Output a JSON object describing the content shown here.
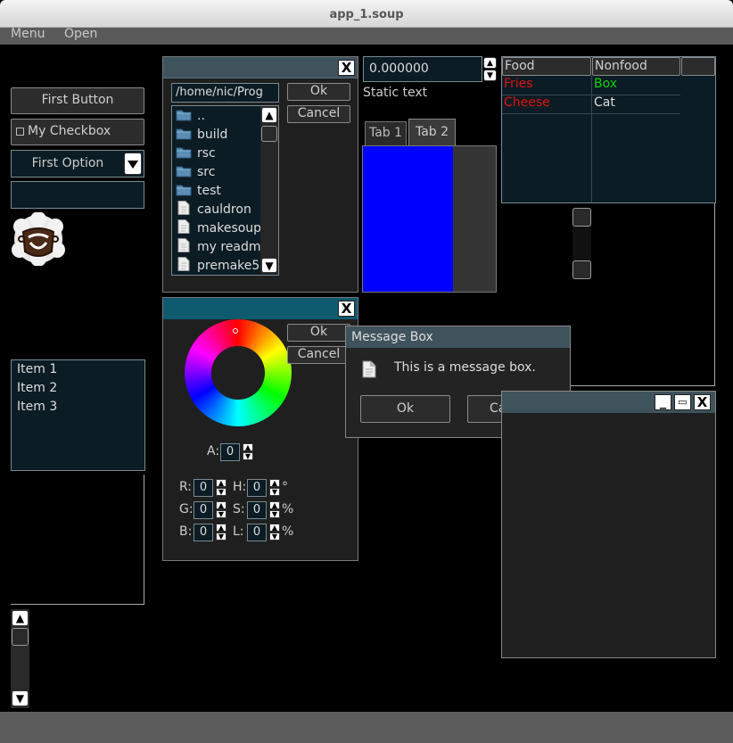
{
  "window": {
    "title": "app_1.soup"
  },
  "menubar": {
    "items": [
      "Menu",
      "Open"
    ]
  },
  "left": {
    "button_label": "First Button",
    "checkbox_label": "My Checkbox",
    "combo_value": "First Option",
    "text_input_value": "",
    "list_items": [
      "Item 1",
      "Item 2",
      "Item 3"
    ]
  },
  "file_dialog": {
    "path": "/home/nic/Prog",
    "ok_label": "Ok",
    "cancel_label": "Cancel",
    "entries": [
      {
        "name": "..",
        "icon": "folder-icon"
      },
      {
        "name": "build",
        "icon": "folder-icon"
      },
      {
        "name": "rsc",
        "icon": "folder-icon"
      },
      {
        "name": "src",
        "icon": "folder-icon"
      },
      {
        "name": "test",
        "icon": "folder-icon"
      },
      {
        "name": "cauldron",
        "icon": "file-icon"
      },
      {
        "name": "makesoup",
        "icon": "file-icon"
      },
      {
        "name": "my readm",
        "icon": "file-icon"
      },
      {
        "name": "premake5.",
        "icon": "file-icon"
      }
    ]
  },
  "numeric": {
    "value": "0.000000",
    "static_text": "Static text"
  },
  "tabs": {
    "items": [
      "Tab 1",
      "Tab 2"
    ],
    "active": "Tab 2",
    "swatch_color": "#0000ff"
  },
  "table": {
    "headers": [
      "Food",
      "Nonfood"
    ],
    "rows": [
      {
        "food": "Fries",
        "food_color": "#e01010",
        "nonfood": "Box",
        "nonfood_color": "#10d010"
      },
      {
        "food": "Cheese",
        "food_color": "#e01010",
        "nonfood": "Cat",
        "nonfood_color": "#dddddd"
      }
    ]
  },
  "color_dialog": {
    "ok_label": "Ok",
    "cancel_label": "Cancel",
    "alpha_label": "A:",
    "alpha_value": "0",
    "fields": [
      {
        "label": "R:",
        "value": "0"
      },
      {
        "label": "H:",
        "value": "0",
        "unit": "°"
      },
      {
        "label": "G:",
        "value": "0"
      },
      {
        "label": "S:",
        "value": "0",
        "unit": "%"
      },
      {
        "label": "B:",
        "value": "0"
      },
      {
        "label": "L:",
        "value": "0",
        "unit": "%"
      }
    ]
  },
  "message_box": {
    "title": "Message Box",
    "text": "This is a message box.",
    "ok_label": "Ok",
    "cancel_label": "Ca"
  },
  "colors": {
    "accent": "#0e5a6e",
    "panel": "#1f1f1f",
    "field": "#0c1c24"
  }
}
